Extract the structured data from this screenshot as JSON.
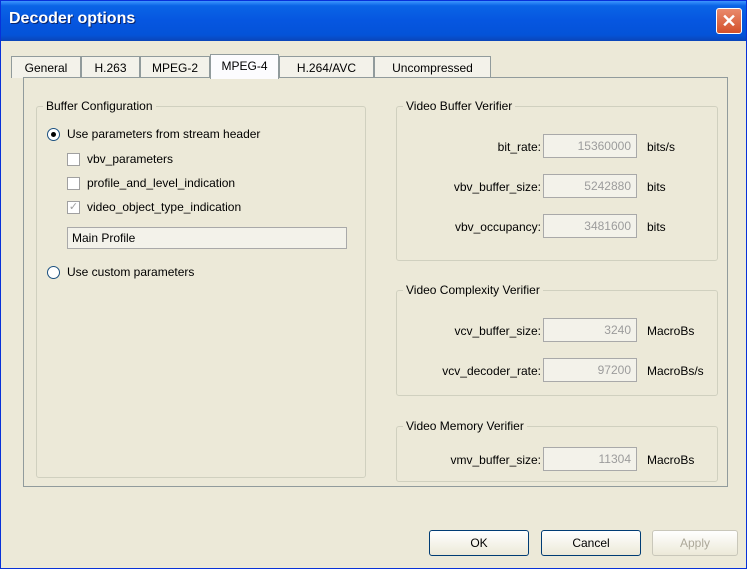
{
  "window": {
    "title": "Decoder options",
    "close": "✕"
  },
  "tabs": [
    {
      "label": "General"
    },
    {
      "label": "H.263"
    },
    {
      "label": "MPEG-2"
    },
    {
      "label": "MPEG-4"
    },
    {
      "label": "H.264/AVC"
    },
    {
      "label": "Uncompressed"
    }
  ],
  "active_tab": "MPEG-4",
  "buffer_config": {
    "title": "Buffer Configuration",
    "use_stream_header_label": "Use parameters from stream header",
    "use_stream_header_checked": true,
    "vbv_parameters_label": "vbv_parameters",
    "vbv_parameters_checked": false,
    "profile_level_label": "profile_and_level_indication",
    "profile_level_checked": false,
    "video_object_type_label": "video_object_type_indication",
    "video_object_type_checked": true,
    "video_object_type_check_glyph": "✓",
    "profile_value": "Main Profile",
    "use_custom_label": "Use custom parameters",
    "use_custom_checked": false
  },
  "vbv": {
    "title": "Video Buffer Verifier",
    "bit_rate_label": "bit_rate:",
    "bit_rate_value": "15360000",
    "bit_rate_unit": "bits/s",
    "buffer_size_label": "vbv_buffer_size:",
    "buffer_size_value": "5242880",
    "buffer_size_unit": "bits",
    "occupancy_label": "vbv_occupancy:",
    "occupancy_value": "3481600",
    "occupancy_unit": "bits"
  },
  "vcv": {
    "title": "Video Complexity Verifier",
    "buffer_size_label": "vcv_buffer_size:",
    "buffer_size_value": "3240",
    "buffer_size_unit": "MacroBs",
    "decoder_rate_label": "vcv_decoder_rate:",
    "decoder_rate_value": "97200",
    "decoder_rate_unit": "MacroBs/s"
  },
  "vmv": {
    "title": "Video Memory Verifier",
    "buffer_size_label": "vmv_buffer_size:",
    "buffer_size_value": "11304",
    "buffer_size_unit": "MacroBs"
  },
  "buttons": {
    "ok": "OK",
    "cancel": "Cancel",
    "apply": "Apply"
  }
}
